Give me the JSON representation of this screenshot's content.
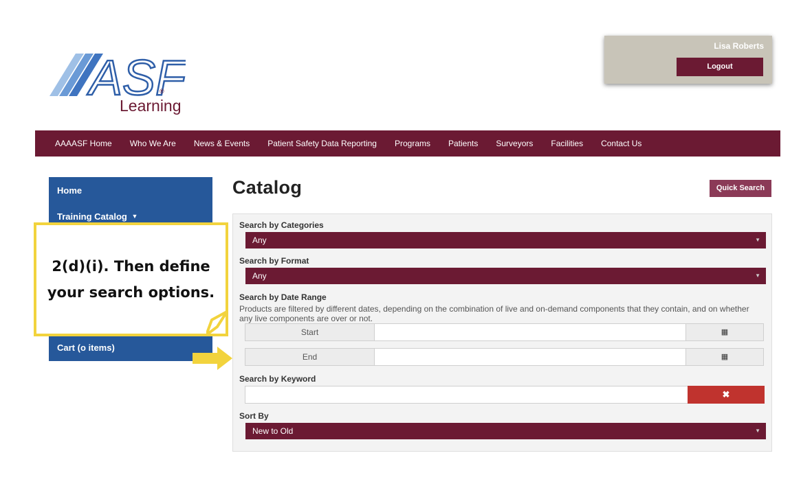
{
  "logo": {
    "mark": "ASF",
    "registered": "®",
    "subtitle": "Learning"
  },
  "user": {
    "name": "Lisa Roberts",
    "logout_label": "Logout"
  },
  "nav": {
    "items": [
      "AAAASF Home",
      "Who We Are",
      "News & Events",
      "Patient Safety Data Reporting",
      "Programs",
      "Patients",
      "Surveyors",
      "Facilities",
      "Contact Us"
    ]
  },
  "sidebar": {
    "home": "Home",
    "training_catalog": "Training Catalog",
    "cart": "Cart (o items)"
  },
  "callout": {
    "line1": "2(d)(i).  Then define",
    "line2": "your search options."
  },
  "page": {
    "title": "Catalog",
    "quick_search_label": "Quick Search"
  },
  "search": {
    "categories_label": "Search by Categories",
    "categories_value": "Any",
    "format_label": "Search by Format",
    "format_value": "Any",
    "date_label": "Search by Date Range",
    "date_description": "Products are filtered by different dates, depending on the combination of live and on-demand components that they contain, and on whether any live components are over or not.",
    "start_label": "Start",
    "end_label": "End",
    "keyword_label": "Search by Keyword",
    "keyword_value": "",
    "clear_glyph": "✖",
    "sort_label": "Sort By",
    "sort_value": "New to Old"
  },
  "icons": {
    "calendar": "calendar-icon",
    "caret": "caret-down-icon",
    "clear": "times-icon"
  },
  "colors": {
    "nav_bg": "#6b1a33",
    "sidebar_bg": "#26589a",
    "callout_border": "#f2d33d",
    "clear_btn": "#c0332e",
    "quick_search_bg": "#8b3a57"
  }
}
